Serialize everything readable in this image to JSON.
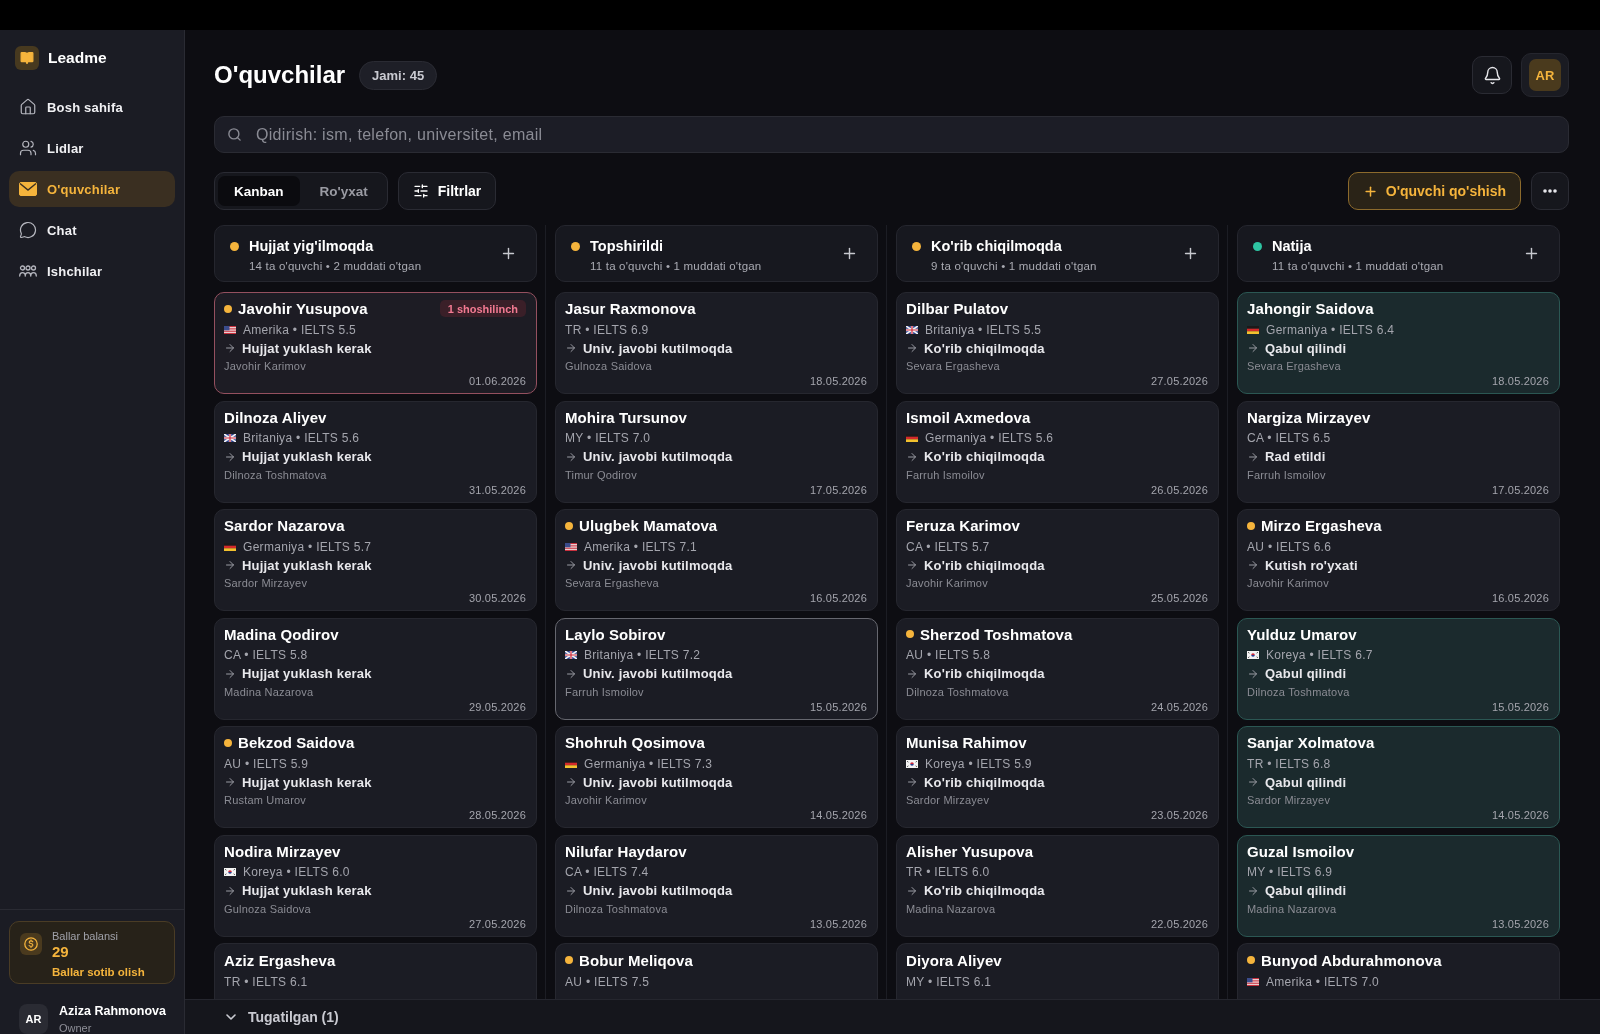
{
  "sidebar": {
    "brand": "Leadme",
    "nav": [
      {
        "label": "Bosh sahifa",
        "selected": false
      },
      {
        "label": "Lidlar",
        "selected": false
      },
      {
        "label": "O'quvchilar",
        "selected": true
      },
      {
        "label": "Chat",
        "selected": false
      },
      {
        "label": "Ishchilar",
        "selected": false
      }
    ],
    "balance": {
      "label": "Ballar balansi",
      "value": "29",
      "action": "Ballar sotib olish"
    },
    "user": {
      "initials": "AR",
      "name": "Aziza Rahmonova",
      "role": "Owner"
    }
  },
  "header": {
    "title": "O'quvchilar",
    "count": "Jami: 45",
    "avatar": "AR"
  },
  "search": {
    "placeholder": "Qidirish: ism, telefon, universitet, email"
  },
  "toolbar": {
    "view_tabs": [
      {
        "label": "Kanban",
        "selected": true
      },
      {
        "label": "Ro'yxat",
        "selected": false
      }
    ],
    "filter_button": "Filtrlar",
    "add_button": "O'quvchi qo'shish"
  },
  "board": {
    "columns": [
      {
        "title": "Hujjat yig'ilmoqda",
        "subtitle": "14 ta o'quvchi • 2 muddati o'tgan",
        "color": "#f5b43c",
        "cards": [
          {
            "name": "Javohir Yusupova",
            "flagged": true,
            "badge": "1 shoshilinch",
            "flag": {
              "kind": "us"
            },
            "meta": "Amerika • IELTS 5.5",
            "action": "Hujjat yuklash kerak",
            "advisor": "Javohir Karimov",
            "date": "01.06.2026",
            "kind": "urgent",
            "selected": false
          },
          {
            "name": "Dilnoza Aliyev",
            "flagged": false,
            "flag": {
              "kind": "gb"
            },
            "meta": "Britaniya • IELTS 5.6",
            "action": "Hujjat yuklash kerak",
            "advisor": "Dilnoza Toshmatova",
            "date": "31.05.2026",
            "kind": "default",
            "selected": false
          },
          {
            "name": "Sardor Nazarova",
            "flagged": false,
            "flag": {
              "kind": "de"
            },
            "meta": "Germaniya • IELTS 5.7",
            "action": "Hujjat yuklash kerak",
            "advisor": "Sardor Mirzayev",
            "date": "30.05.2026",
            "kind": "default",
            "selected": false
          },
          {
            "name": "Madina Qodirov",
            "flagged": false,
            "meta": "CA • IELTS 5.8",
            "action": "Hujjat yuklash kerak",
            "advisor": "Madina Nazarova",
            "date": "29.05.2026",
            "kind": "default",
            "selected": false
          },
          {
            "name": "Bekzod Saidova",
            "flagged": true,
            "meta": "AU • IELTS 5.9",
            "action": "Hujjat yuklash kerak",
            "advisor": "Rustam Umarov",
            "date": "28.05.2026",
            "kind": "default",
            "selected": false
          },
          {
            "name": "Nodira Mirzayev",
            "flagged": false,
            "flag": {
              "kind": "kr"
            },
            "meta": "Koreya • IELTS 6.0",
            "action": "Hujjat yuklash kerak",
            "advisor": "Gulnoza Saidova",
            "date": "27.05.2026",
            "kind": "default",
            "selected": false
          },
          {
            "name": "Aziz Ergasheva",
            "flagged": false,
            "meta": "TR • IELTS 6.1",
            "kind": "default",
            "selected": false
          }
        ]
      },
      {
        "title": "Topshirildi",
        "subtitle": "11 ta o'quvchi • 1 muddati o'tgan",
        "color": "#f5b43c",
        "cards": [
          {
            "name": "Jasur Raxmonova",
            "flagged": false,
            "meta": "TR • IELTS 6.9",
            "action": "Univ. javobi kutilmoqda",
            "advisor": "Gulnoza Saidova",
            "date": "18.05.2026",
            "kind": "default",
            "selected": false
          },
          {
            "name": "Mohira Tursunov",
            "flagged": false,
            "meta": "MY • IELTS 7.0",
            "action": "Univ. javobi kutilmoqda",
            "advisor": "Timur Qodirov",
            "date": "17.05.2026",
            "kind": "default",
            "selected": false
          },
          {
            "name": "Ulugbek Mamatova",
            "flagged": true,
            "flag": {
              "kind": "us"
            },
            "meta": "Amerika • IELTS 7.1",
            "action": "Univ. javobi kutilmoqda",
            "advisor": "Sevara Ergasheva",
            "date": "16.05.2026",
            "kind": "default",
            "selected": false
          },
          {
            "name": "Laylo Sobirov",
            "flagged": false,
            "flag": {
              "kind": "gb"
            },
            "meta": "Britaniya • IELTS 7.2",
            "action": "Univ. javobi kutilmoqda",
            "advisor": "Farruh Ismoilov",
            "date": "15.05.2026",
            "kind": "default",
            "selected": true
          },
          {
            "name": "Shohruh Qosimova",
            "flagged": false,
            "flag": {
              "kind": "de"
            },
            "meta": "Germaniya • IELTS 7.3",
            "action": "Univ. javobi kutilmoqda",
            "advisor": "Javohir Karimov",
            "date": "14.05.2026",
            "kind": "default",
            "selected": false
          },
          {
            "name": "Nilufar Haydarov",
            "flagged": false,
            "meta": "CA • IELTS 7.4",
            "action": "Univ. javobi kutilmoqda",
            "advisor": "Dilnoza Toshmatova",
            "date": "13.05.2026",
            "kind": "default",
            "selected": false
          },
          {
            "name": "Bobur Meliqova",
            "flagged": true,
            "meta": "AU • IELTS 7.5",
            "kind": "default",
            "selected": false
          }
        ]
      },
      {
        "title": "Ko'rib chiqilmoqda",
        "subtitle": "9 ta o'quvchi • 1 muddati o'tgan",
        "color": "#f5b43c",
        "cards": [
          {
            "name": "Dilbar Pulatov",
            "flagged": false,
            "flag": {
              "kind": "gb"
            },
            "meta": "Britaniya • IELTS 5.5",
            "action": "Ko'rib chiqilmoqda",
            "advisor": "Sevara Ergasheva",
            "date": "27.05.2026",
            "kind": "default",
            "selected": false
          },
          {
            "name": "Ismoil Axmedova",
            "flagged": false,
            "flag": {
              "kind": "de"
            },
            "meta": "Germaniya • IELTS 5.6",
            "action": "Ko'rib chiqilmoqda",
            "advisor": "Farruh Ismoilov",
            "date": "26.05.2026",
            "kind": "default",
            "selected": false
          },
          {
            "name": "Feruza Karimov",
            "flagged": false,
            "meta": "CA • IELTS 5.7",
            "action": "Ko'rib chiqilmoqda",
            "advisor": "Javohir Karimov",
            "date": "25.05.2026",
            "kind": "default",
            "selected": false
          },
          {
            "name": "Sherzod Toshmatova",
            "flagged": true,
            "meta": "AU • IELTS 5.8",
            "action": "Ko'rib chiqilmoqda",
            "advisor": "Dilnoza Toshmatova",
            "date": "24.05.2026",
            "kind": "default",
            "selected": false
          },
          {
            "name": "Munisa Rahimov",
            "flagged": false,
            "flag": {
              "kind": "kr"
            },
            "meta": "Koreya • IELTS 5.9",
            "action": "Ko'rib chiqilmoqda",
            "advisor": "Sardor Mirzayev",
            "date": "23.05.2026",
            "kind": "default",
            "selected": false
          },
          {
            "name": "Alisher Yusupova",
            "flagged": false,
            "meta": "TR • IELTS 6.0",
            "action": "Ko'rib chiqilmoqda",
            "advisor": "Madina Nazarova",
            "date": "22.05.2026",
            "kind": "default",
            "selected": false
          },
          {
            "name": "Diyora Aliyev",
            "flagged": false,
            "meta": "MY • IELTS 6.1",
            "kind": "default",
            "selected": false
          }
        ]
      },
      {
        "title": "Natija",
        "subtitle": "11 ta o'quvchi • 1 muddati o'tgan",
        "color": "#2ec4a2",
        "cards": [
          {
            "name": "Jahongir Saidova",
            "flagged": false,
            "flag": {
              "kind": "de"
            },
            "meta": "Germaniya • IELTS 6.4",
            "action": "Qabul qilindi",
            "advisor": "Sevara Ergasheva",
            "date": "18.05.2026",
            "kind": "accepted",
            "selected": false
          },
          {
            "name": "Nargiza Mirzayev",
            "flagged": false,
            "meta": "CA • IELTS 6.5",
            "action": "Rad etildi",
            "advisor": "Farruh Ismoilov",
            "date": "17.05.2026",
            "kind": "default",
            "selected": false
          },
          {
            "name": "Mirzo Ergasheva",
            "flagged": true,
            "meta": "AU • IELTS 6.6",
            "action": "Kutish ro'yxati",
            "advisor": "Javohir Karimov",
            "date": "16.05.2026",
            "kind": "default",
            "selected": false
          },
          {
            "name": "Yulduz Umarov",
            "flagged": false,
            "flag": {
              "kind": "kr"
            },
            "meta": "Koreya • IELTS 6.7",
            "action": "Qabul qilindi",
            "advisor": "Dilnoza Toshmatova",
            "date": "15.05.2026",
            "kind": "accepted",
            "selected": false
          },
          {
            "name": "Sanjar Xolmatova",
            "flagged": false,
            "meta": "TR • IELTS 6.8",
            "action": "Qabul qilindi",
            "advisor": "Sardor Mirzayev",
            "date": "14.05.2026",
            "kind": "accepted",
            "selected": false
          },
          {
            "name": "Guzal Ismoilov",
            "flagged": false,
            "meta": "MY • IELTS 6.9",
            "action": "Qabul qilindi",
            "advisor": "Madina Nazarova",
            "date": "13.05.2026",
            "kind": "accepted",
            "selected": false
          },
          {
            "name": "Bunyod Abdurahmonova",
            "flagged": true,
            "flag": {
              "kind": "us"
            },
            "meta": "Amerika • IELTS 7.0",
            "kind": "default",
            "selected": false
          }
        ]
      }
    ]
  },
  "footer": {
    "label": "Tugatilgan (1)"
  }
}
